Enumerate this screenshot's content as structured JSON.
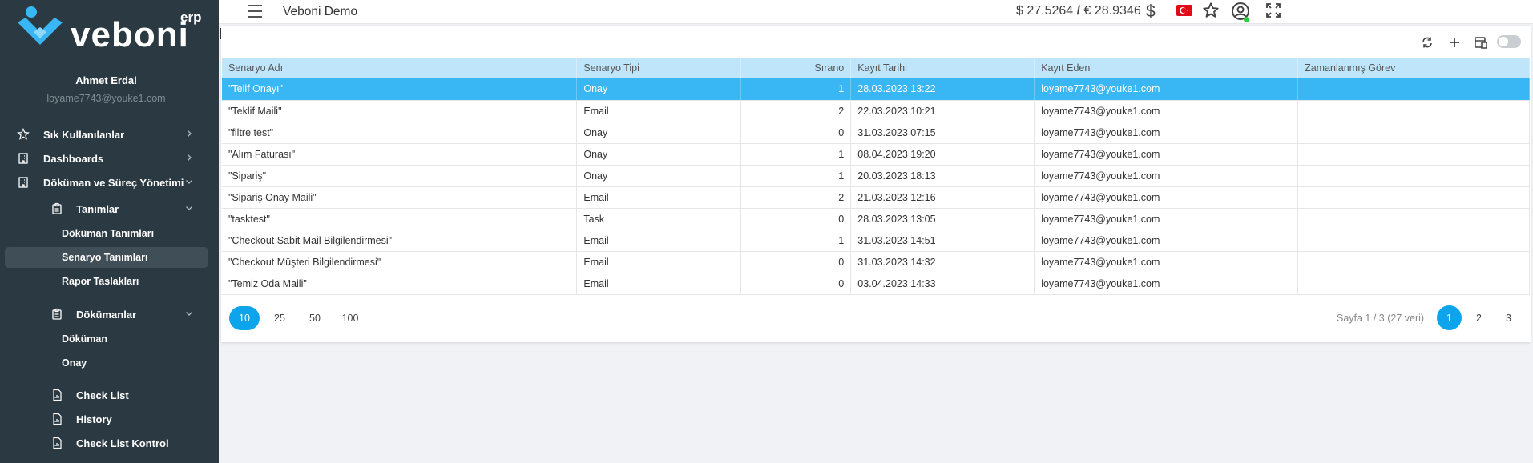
{
  "brand": {
    "name": "veboni",
    "suffix": "erp"
  },
  "user": {
    "name": "Ahmet Erdal",
    "email": "loyame7743@youke1.com"
  },
  "sidebar": {
    "items": [
      {
        "label": "Sık Kullanılanlar",
        "icon": "star-outline-icon"
      },
      {
        "label": "Dashboards",
        "icon": "building-icon"
      },
      {
        "label": "Döküman ve Süreç Yönetimi",
        "icon": "building-icon"
      }
    ],
    "groups": [
      {
        "label": "Tanımlar",
        "icon": "clipboard-icon",
        "children": [
          "Döküman Tanımları",
          "Senaryo Tanımları",
          "Rapor Taslakları"
        ]
      },
      {
        "label": "Dökümanlar",
        "icon": "clipboard-icon",
        "children": [
          "Döküman",
          "Onay"
        ]
      }
    ],
    "extra": [
      {
        "label": "Check List",
        "icon": "report-icon"
      },
      {
        "label": "History",
        "icon": "report-icon"
      },
      {
        "label": "Check List Kontrol",
        "icon": "report-icon"
      }
    ],
    "active": "Senaryo Tanımları"
  },
  "header": {
    "title": "Veboni Demo",
    "usd": "$ 27.5264",
    "separator": "/",
    "eur": "€ 28.9346",
    "currency_symbol": "$"
  },
  "table": {
    "columns": [
      "Senaryo Adı",
      "Senaryo Tipi",
      "Sırano",
      "Kayıt Tarihi",
      "Kayıt Eden",
      "Zamanlanmış Görev"
    ],
    "rows": [
      [
        "\"Telif Onayı\"",
        "Onay",
        "1",
        "28.03.2023 13:22",
        "loyame7743@youke1.com",
        ""
      ],
      [
        "\"Teklif Maili\"",
        "Email",
        "2",
        "22.03.2023 10:21",
        "loyame7743@youke1.com",
        ""
      ],
      [
        "\"filtre test\"",
        "Onay",
        "0",
        "31.03.2023 07:15",
        "loyame7743@youke1.com",
        ""
      ],
      [
        "\"Alım Faturası\"",
        "Onay",
        "1",
        "08.04.2023 19:20",
        "loyame7743@youke1.com",
        ""
      ],
      [
        "\"Sipariş\"",
        "Onay",
        "1",
        "20.03.2023 18:13",
        "loyame7743@youke1.com",
        ""
      ],
      [
        "\"Sipariş Onay Maili\"",
        "Email",
        "2",
        "21.03.2023 12:16",
        "loyame7743@youke1.com",
        ""
      ],
      [
        "\"tasktest\"",
        "Task",
        "0",
        "28.03.2023 13:05",
        "loyame7743@youke1.com",
        ""
      ],
      [
        "\"Checkout Sabit Mail Bilgilendirmesi\"",
        "Email",
        "1",
        "31.03.2023 14:51",
        "loyame7743@youke1.com",
        ""
      ],
      [
        "\"Checkout Müşteri Bilgilendirmesi\"",
        "Email",
        "0",
        "31.03.2023 14:32",
        "loyame7743@youke1.com",
        ""
      ],
      [
        "\"Temiz Oda Maili\"",
        "Email",
        "0",
        "03.04.2023 14:33",
        "loyame7743@youke1.com",
        ""
      ]
    ],
    "selected_row": 0
  },
  "pager": {
    "sizes": [
      "10",
      "25",
      "50",
      "100"
    ],
    "active_size": "10",
    "info": "Sayfa 1 / 3 (27 veri)",
    "pages": [
      "1",
      "2",
      "3"
    ],
    "active_page": "1"
  },
  "colors": {
    "sidebar": "#2b3a42",
    "accent": "#0ca5ec",
    "selected_row": "#38b7f4",
    "header_row": "#bfe5fb"
  }
}
